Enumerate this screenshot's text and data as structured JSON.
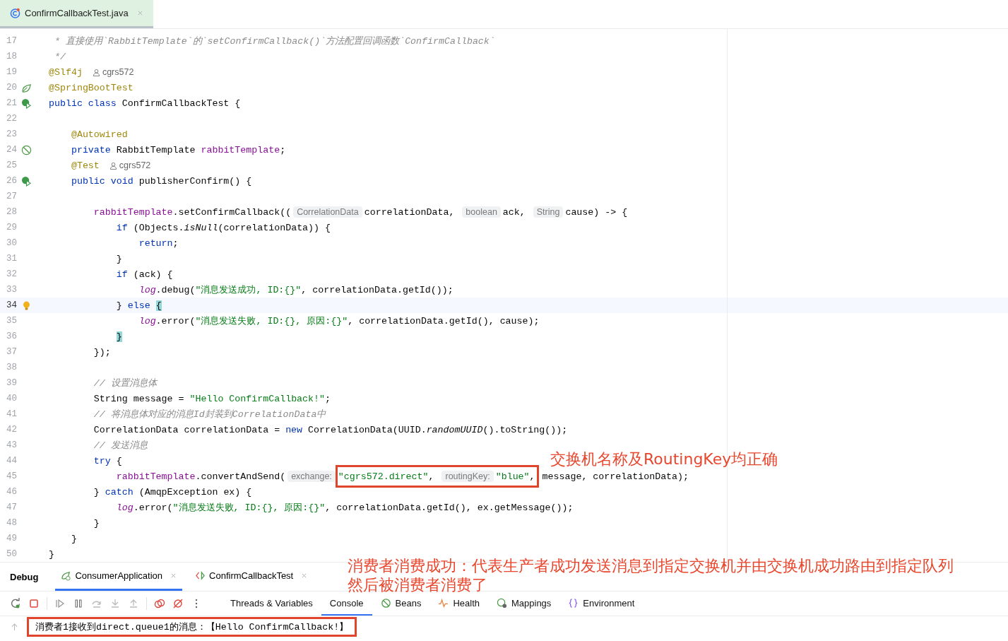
{
  "editor_tabs": [
    {
      "label": "ConfirmCallbackTest.java",
      "selected": true
    }
  ],
  "code_lines": [
    {
      "n": "17",
      "tokens": [
        {
          "t": " * 直接使用`RabbitTemplate`的`setConfirmCallback()`方法配置回调函数`ConfirmCallback`",
          "kind": "comment"
        }
      ]
    },
    {
      "n": "18",
      "tokens": [
        {
          "t": " */",
          "kind": "comment"
        }
      ]
    },
    {
      "n": "19",
      "tokens": [
        {
          "t": "@Slf4j",
          "kind": "annotation"
        },
        {
          "t": "cgrs572",
          "kind": "author"
        }
      ]
    },
    {
      "n": "20",
      "gutter": {
        "kind": "bean"
      },
      "tokens": [
        {
          "t": "@SpringBootTest",
          "kind": "annotation"
        }
      ]
    },
    {
      "n": "21",
      "gutter": {
        "kind": "run"
      },
      "tokens": [
        {
          "t": "public class ",
          "kind": "keyword"
        },
        {
          "t": "ConfirmCallbackTest {",
          "kind": "plain"
        }
      ]
    },
    {
      "n": "22"
    },
    {
      "n": "23",
      "tokens": [
        {
          "t": "    @Autowired",
          "kind": "annotation"
        }
      ]
    },
    {
      "n": "24",
      "gutter": {
        "kind": "autowired"
      },
      "tokens": [
        {
          "t": "    private ",
          "kind": "keyword"
        },
        {
          "t": "RabbitTemplate ",
          "kind": "plain"
        },
        {
          "t": "rabbitTemplate",
          "kind": "field"
        },
        {
          "t": ";",
          "kind": "plain"
        }
      ]
    },
    {
      "n": "25",
      "tokens": [
        {
          "t": "    @Test",
          "kind": "annotation"
        },
        {
          "t": "cgrs572",
          "kind": "author"
        }
      ]
    },
    {
      "n": "26",
      "gutter": {
        "kind": "run"
      },
      "tokens": [
        {
          "t": "    public void ",
          "kind": "keyword"
        },
        {
          "t": "publisherConfirm() {",
          "kind": "plain"
        }
      ]
    },
    {
      "n": "27"
    },
    {
      "n": "28",
      "tokens": [
        {
          "t": "        rabbitTemplate",
          "kind": "field"
        },
        {
          "t": ".setConfirmCallback((",
          "kind": "plain"
        },
        {
          "t": "CorrelationData",
          "kind": "hint"
        },
        {
          "t": "correlationData, ",
          "kind": "plain"
        },
        {
          "t": "boolean",
          "kind": "hint"
        },
        {
          "t": "ack, ",
          "kind": "plain"
        },
        {
          "t": "String",
          "kind": "hint"
        },
        {
          "t": "cause) -> {",
          "kind": "plain"
        }
      ]
    },
    {
      "n": "29",
      "tokens": [
        {
          "t": "            if ",
          "kind": "keyword"
        },
        {
          "t": "(Objects.",
          "kind": "plain"
        },
        {
          "t": "isNull",
          "kind": "static"
        },
        {
          "t": "(correlationData)) {",
          "kind": "plain"
        }
      ]
    },
    {
      "n": "30",
      "tokens": [
        {
          "t": "                return",
          "kind": "keyword"
        },
        {
          "t": ";",
          "kind": "plain"
        }
      ]
    },
    {
      "n": "31",
      "tokens": [
        {
          "t": "            }",
          "kind": "plain"
        }
      ]
    },
    {
      "n": "32",
      "tokens": [
        {
          "t": "            if ",
          "kind": "keyword"
        },
        {
          "t": "(ack) {",
          "kind": "plain"
        }
      ]
    },
    {
      "n": "33",
      "tokens": [
        {
          "t": "                log",
          "kind": "logger"
        },
        {
          "t": ".debug(",
          "kind": "plain"
        },
        {
          "t": "\"消息发送成功, ID:{}\"",
          "kind": "string"
        },
        {
          "t": ", correlationData.getId());",
          "kind": "plain"
        }
      ]
    },
    {
      "n": "34",
      "current": true,
      "gutter": {
        "kind": "bulb"
      },
      "tokens": [
        {
          "t": "            } ",
          "kind": "plain"
        },
        {
          "t": "else ",
          "kind": "keyword"
        },
        {
          "t": "{",
          "kind": "match"
        }
      ]
    },
    {
      "n": "35",
      "tokens": [
        {
          "t": "                log",
          "kind": "logger"
        },
        {
          "t": ".error(",
          "kind": "plain"
        },
        {
          "t": "\"消息发送失败, ID:{}, 原因:{}\"",
          "kind": "string"
        },
        {
          "t": ", correlationData.getId(), cause);",
          "kind": "plain"
        }
      ]
    },
    {
      "n": "36",
      "tokens": [
        {
          "t": "            }",
          "kind": "match"
        }
      ]
    },
    {
      "n": "37",
      "tokens": [
        {
          "t": "        });",
          "kind": "plain"
        }
      ]
    },
    {
      "n": "38"
    },
    {
      "n": "39",
      "tokens": [
        {
          "t": "        // 设置消息体",
          "kind": "comment"
        }
      ]
    },
    {
      "n": "40",
      "tokens": [
        {
          "t": "        String message = ",
          "kind": "plain"
        },
        {
          "t": "\"Hello ConfirmCallback!\"",
          "kind": "string"
        },
        {
          "t": ";",
          "kind": "plain"
        }
      ]
    },
    {
      "n": "41",
      "tokens": [
        {
          "t": "        // 将消息体对应的消息Id封装到CorrelationData中",
          "kind": "comment"
        }
      ]
    },
    {
      "n": "42",
      "tokens": [
        {
          "t": "        CorrelationData correlationData = ",
          "kind": "plain"
        },
        {
          "t": "new ",
          "kind": "keyword"
        },
        {
          "t": "CorrelationData(UUID.",
          "kind": "plain"
        },
        {
          "t": "randomUUID",
          "kind": "static"
        },
        {
          "t": "().toString());",
          "kind": "plain"
        }
      ]
    },
    {
      "n": "43",
      "tokens": [
        {
          "t": "        // 发送消息",
          "kind": "comment"
        }
      ]
    },
    {
      "n": "44",
      "tokens": [
        {
          "t": "        try ",
          "kind": "keyword"
        },
        {
          "t": "{",
          "kind": "plain"
        }
      ]
    },
    {
      "n": "45",
      "tokens": [
        {
          "t": "            rabbitTemplate",
          "kind": "field"
        },
        {
          "t": ".convertAndSend(",
          "kind": "plain"
        },
        {
          "t": "exchange:",
          "kind": "hint"
        },
        {
          "t": "\"cgrs572.direct\"",
          "kind": "string",
          "boxed": true
        },
        {
          "t": ", ",
          "kind": "plain",
          "boxed": true
        },
        {
          "t": "routingKey:",
          "kind": "hint",
          "boxed": true
        },
        {
          "t": "\"blue\"",
          "kind": "string",
          "boxed": true
        },
        {
          "t": ",",
          "kind": "plain",
          "boxed": true
        },
        {
          "t": " message, correlationData);",
          "kind": "plain"
        }
      ]
    },
    {
      "n": "46",
      "tokens": [
        {
          "t": "        } ",
          "kind": "plain"
        },
        {
          "t": "catch ",
          "kind": "keyword"
        },
        {
          "t": "(AmqpException ex) {",
          "kind": "plain"
        }
      ]
    },
    {
      "n": "47",
      "tokens": [
        {
          "t": "            log",
          "kind": "logger"
        },
        {
          "t": ".error(",
          "kind": "plain"
        },
        {
          "t": "\"消息发送失败, ID:{}, 原因:{}\"",
          "kind": "string"
        },
        {
          "t": ", correlationData.getId(), ex.getMessage());",
          "kind": "plain"
        }
      ]
    },
    {
      "n": "48",
      "tokens": [
        {
          "t": "        }",
          "kind": "plain"
        }
      ]
    },
    {
      "n": "49",
      "tokens": [
        {
          "t": "    }",
          "kind": "plain"
        }
      ]
    },
    {
      "n": "50",
      "tokens": [
        {
          "t": "}",
          "kind": "plain"
        }
      ]
    }
  ],
  "annotations": [
    {
      "lines": [
        "交换机名称及RoutingKey均正确"
      ]
    },
    {
      "lines": [
        "消费者消费成功：代表生产者成功发送消息到指定交换机并由交换机成功路由到指定队列",
        "然后被消费者消费了"
      ]
    }
  ],
  "debug": {
    "title": "Debug",
    "session_tabs": [
      {
        "label": "ConsumerApplication",
        "kind": "spring",
        "selected": true
      },
      {
        "label": "ConfirmCallbackTest",
        "kind": "test",
        "selected": false
      }
    ],
    "tool_tabs": [
      {
        "label": "Threads & Variables",
        "selected": false
      },
      {
        "label": "Console",
        "selected": true
      },
      {
        "label": "Beans",
        "kind": "beans",
        "selected": false
      },
      {
        "label": "Health",
        "kind": "health",
        "selected": false
      },
      {
        "label": "Mappings",
        "kind": "mappings",
        "selected": false
      },
      {
        "label": "Environment",
        "kind": "environment",
        "selected": false
      }
    ],
    "console_lines": [
      {
        "text": "消费者1接收到direct.queue1的消息：【Hello ConfirmCallback!】",
        "boxed": true
      }
    ]
  }
}
